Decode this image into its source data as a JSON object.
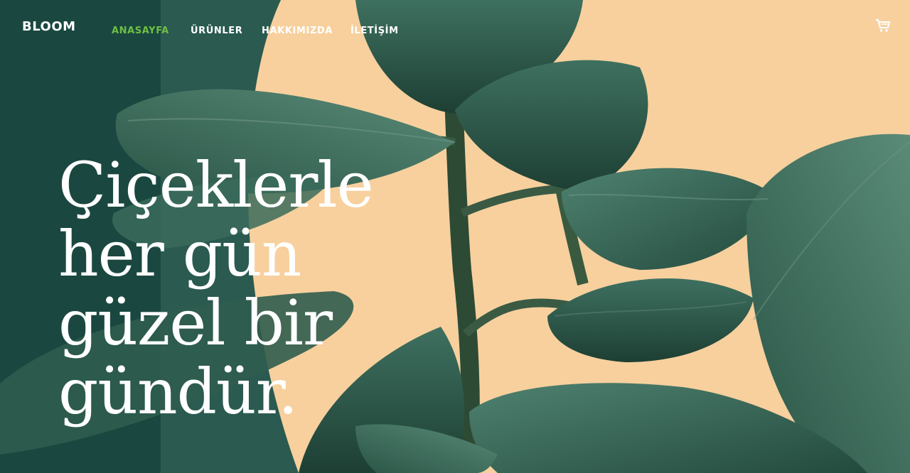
{
  "brand": {
    "logo_text": "BLOOM"
  },
  "nav": {
    "items": [
      {
        "label": "ANASAYFA",
        "active": true
      },
      {
        "label": "ÜRÜNLER",
        "active": false
      },
      {
        "label": "HAKKIMIZDA",
        "active": false
      },
      {
        "label": "İLETİŞİM",
        "active": false
      }
    ],
    "active_color": "#6fbf43"
  },
  "cart": {
    "icon": "cart-icon"
  },
  "hero": {
    "lines": [
      "Çiçeklerle",
      "her gün",
      "güzel bir",
      "gündür."
    ]
  },
  "colors": {
    "dark_green": "#1a4840",
    "peach": "#f7d09e",
    "leaf": "#2e5e4c"
  }
}
